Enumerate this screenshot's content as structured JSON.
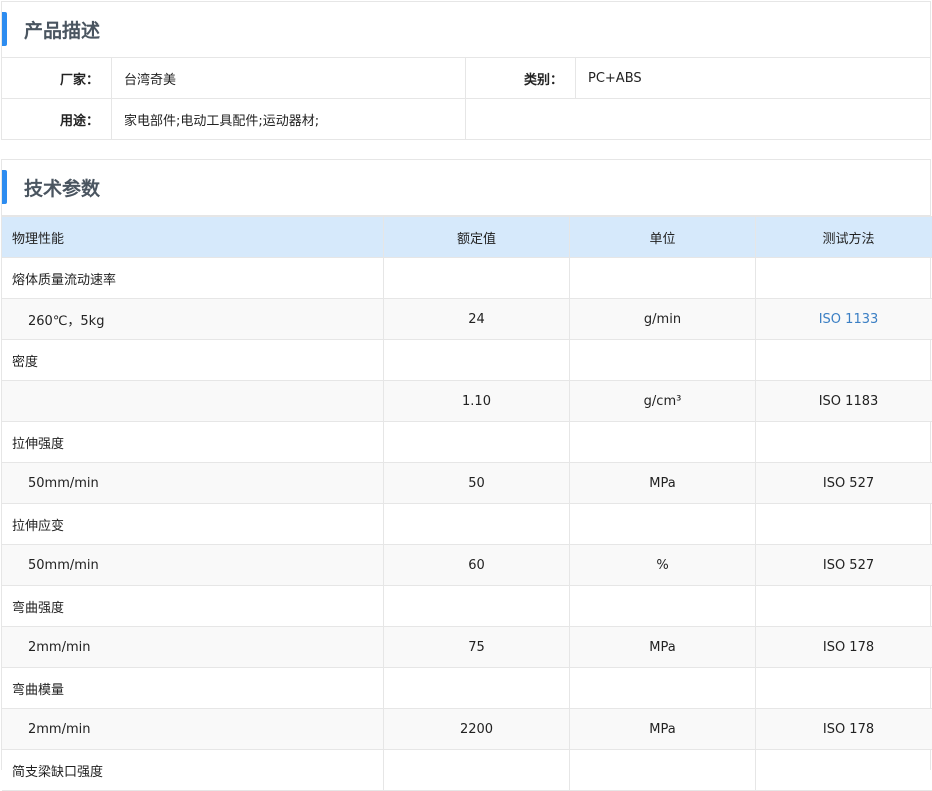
{
  "description": {
    "title": "产品描述",
    "manufacturer_label": "厂家：",
    "manufacturer": "台湾奇美",
    "category_label": "类别：",
    "category": "PC+ABS",
    "usage_label": "用途：",
    "usage": "家电部件;电动工具配件;运动器材;"
  },
  "tech": {
    "title": "技术参数",
    "headers": [
      "物理性能",
      "额定值",
      "单位",
      "测试方法"
    ],
    "rows": [
      {
        "type": "group",
        "cells": [
          "熔体质量流动速率",
          "",
          "",
          ""
        ]
      },
      {
        "type": "sub",
        "cells": [
          "260℃，5kg",
          "24",
          "g/min",
          "ISO 1133"
        ]
      },
      {
        "type": "group",
        "cells": [
          "密度",
          "",
          "",
          ""
        ]
      },
      {
        "type": "sub",
        "cells": [
          "",
          "1.10",
          "g/cm³",
          "ISO 1183"
        ]
      },
      {
        "type": "group",
        "cells": [
          "拉伸强度",
          "",
          "",
          ""
        ]
      },
      {
        "type": "sub",
        "cells": [
          "50mm/min",
          "50",
          "MPa",
          "ISO 527"
        ]
      },
      {
        "type": "group",
        "cells": [
          "拉伸应变",
          "",
          "",
          ""
        ]
      },
      {
        "type": "sub",
        "cells": [
          "50mm/min",
          "60",
          "%",
          "ISO 527"
        ]
      },
      {
        "type": "group",
        "cells": [
          "弯曲强度",
          "",
          "",
          ""
        ]
      },
      {
        "type": "sub",
        "cells": [
          "2mm/min",
          "75",
          "MPa",
          "ISO 178"
        ]
      },
      {
        "type": "group",
        "cells": [
          "弯曲模量",
          "",
          "",
          ""
        ]
      },
      {
        "type": "sub",
        "cells": [
          "2mm/min",
          "2200",
          "MPa",
          "ISO 178"
        ]
      },
      {
        "type": "group",
        "cells": [
          "简支梁缺口强度",
          "",
          "",
          ""
        ]
      }
    ]
  },
  "colors": {
    "accent": "#2d8cf0",
    "header_bg": "#d6e9fb",
    "link": "#3b7fc4"
  }
}
